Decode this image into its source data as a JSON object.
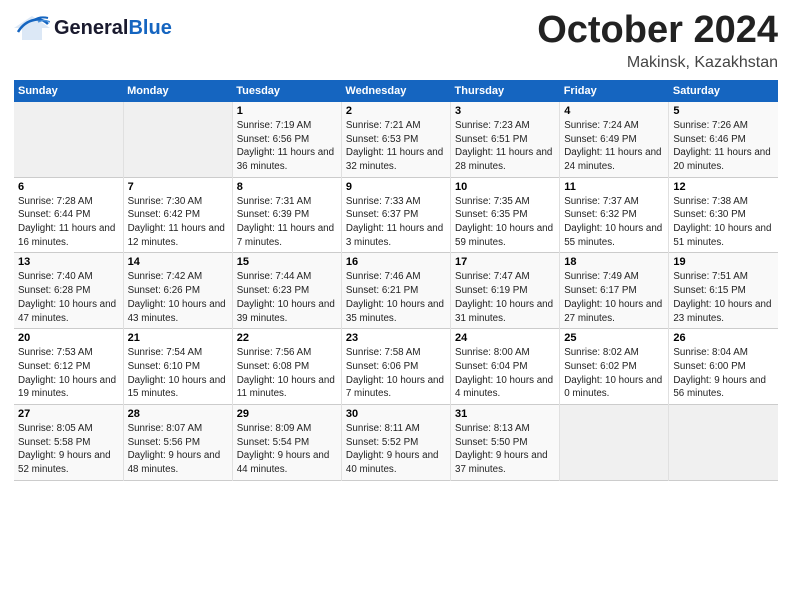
{
  "header": {
    "logo_general": "General",
    "logo_blue": "Blue",
    "month": "October 2024",
    "location": "Makinsk, Kazakhstan"
  },
  "weekdays": [
    "Sunday",
    "Monday",
    "Tuesday",
    "Wednesday",
    "Thursday",
    "Friday",
    "Saturday"
  ],
  "weeks": [
    [
      {
        "day": "",
        "empty": true
      },
      {
        "day": "",
        "empty": true
      },
      {
        "day": "1",
        "sunrise": "Sunrise: 7:19 AM",
        "sunset": "Sunset: 6:56 PM",
        "daylight": "Daylight: 11 hours and 36 minutes."
      },
      {
        "day": "2",
        "sunrise": "Sunrise: 7:21 AM",
        "sunset": "Sunset: 6:53 PM",
        "daylight": "Daylight: 11 hours and 32 minutes."
      },
      {
        "day": "3",
        "sunrise": "Sunrise: 7:23 AM",
        "sunset": "Sunset: 6:51 PM",
        "daylight": "Daylight: 11 hours and 28 minutes."
      },
      {
        "day": "4",
        "sunrise": "Sunrise: 7:24 AM",
        "sunset": "Sunset: 6:49 PM",
        "daylight": "Daylight: 11 hours and 24 minutes."
      },
      {
        "day": "5",
        "sunrise": "Sunrise: 7:26 AM",
        "sunset": "Sunset: 6:46 PM",
        "daylight": "Daylight: 11 hours and 20 minutes."
      }
    ],
    [
      {
        "day": "6",
        "sunrise": "Sunrise: 7:28 AM",
        "sunset": "Sunset: 6:44 PM",
        "daylight": "Daylight: 11 hours and 16 minutes."
      },
      {
        "day": "7",
        "sunrise": "Sunrise: 7:30 AM",
        "sunset": "Sunset: 6:42 PM",
        "daylight": "Daylight: 11 hours and 12 minutes."
      },
      {
        "day": "8",
        "sunrise": "Sunrise: 7:31 AM",
        "sunset": "Sunset: 6:39 PM",
        "daylight": "Daylight: 11 hours and 7 minutes."
      },
      {
        "day": "9",
        "sunrise": "Sunrise: 7:33 AM",
        "sunset": "Sunset: 6:37 PM",
        "daylight": "Daylight: 11 hours and 3 minutes."
      },
      {
        "day": "10",
        "sunrise": "Sunrise: 7:35 AM",
        "sunset": "Sunset: 6:35 PM",
        "daylight": "Daylight: 10 hours and 59 minutes."
      },
      {
        "day": "11",
        "sunrise": "Sunrise: 7:37 AM",
        "sunset": "Sunset: 6:32 PM",
        "daylight": "Daylight: 10 hours and 55 minutes."
      },
      {
        "day": "12",
        "sunrise": "Sunrise: 7:38 AM",
        "sunset": "Sunset: 6:30 PM",
        "daylight": "Daylight: 10 hours and 51 minutes."
      }
    ],
    [
      {
        "day": "13",
        "sunrise": "Sunrise: 7:40 AM",
        "sunset": "Sunset: 6:28 PM",
        "daylight": "Daylight: 10 hours and 47 minutes."
      },
      {
        "day": "14",
        "sunrise": "Sunrise: 7:42 AM",
        "sunset": "Sunset: 6:26 PM",
        "daylight": "Daylight: 10 hours and 43 minutes."
      },
      {
        "day": "15",
        "sunrise": "Sunrise: 7:44 AM",
        "sunset": "Sunset: 6:23 PM",
        "daylight": "Daylight: 10 hours and 39 minutes."
      },
      {
        "day": "16",
        "sunrise": "Sunrise: 7:46 AM",
        "sunset": "Sunset: 6:21 PM",
        "daylight": "Daylight: 10 hours and 35 minutes."
      },
      {
        "day": "17",
        "sunrise": "Sunrise: 7:47 AM",
        "sunset": "Sunset: 6:19 PM",
        "daylight": "Daylight: 10 hours and 31 minutes."
      },
      {
        "day": "18",
        "sunrise": "Sunrise: 7:49 AM",
        "sunset": "Sunset: 6:17 PM",
        "daylight": "Daylight: 10 hours and 27 minutes."
      },
      {
        "day": "19",
        "sunrise": "Sunrise: 7:51 AM",
        "sunset": "Sunset: 6:15 PM",
        "daylight": "Daylight: 10 hours and 23 minutes."
      }
    ],
    [
      {
        "day": "20",
        "sunrise": "Sunrise: 7:53 AM",
        "sunset": "Sunset: 6:12 PM",
        "daylight": "Daylight: 10 hours and 19 minutes."
      },
      {
        "day": "21",
        "sunrise": "Sunrise: 7:54 AM",
        "sunset": "Sunset: 6:10 PM",
        "daylight": "Daylight: 10 hours and 15 minutes."
      },
      {
        "day": "22",
        "sunrise": "Sunrise: 7:56 AM",
        "sunset": "Sunset: 6:08 PM",
        "daylight": "Daylight: 10 hours and 11 minutes."
      },
      {
        "day": "23",
        "sunrise": "Sunrise: 7:58 AM",
        "sunset": "Sunset: 6:06 PM",
        "daylight": "Daylight: 10 hours and 7 minutes."
      },
      {
        "day": "24",
        "sunrise": "Sunrise: 8:00 AM",
        "sunset": "Sunset: 6:04 PM",
        "daylight": "Daylight: 10 hours and 4 minutes."
      },
      {
        "day": "25",
        "sunrise": "Sunrise: 8:02 AM",
        "sunset": "Sunset: 6:02 PM",
        "daylight": "Daylight: 10 hours and 0 minutes."
      },
      {
        "day": "26",
        "sunrise": "Sunrise: 8:04 AM",
        "sunset": "Sunset: 6:00 PM",
        "daylight": "Daylight: 9 hours and 56 minutes."
      }
    ],
    [
      {
        "day": "27",
        "sunrise": "Sunrise: 8:05 AM",
        "sunset": "Sunset: 5:58 PM",
        "daylight": "Daylight: 9 hours and 52 minutes."
      },
      {
        "day": "28",
        "sunrise": "Sunrise: 8:07 AM",
        "sunset": "Sunset: 5:56 PM",
        "daylight": "Daylight: 9 hours and 48 minutes."
      },
      {
        "day": "29",
        "sunrise": "Sunrise: 8:09 AM",
        "sunset": "Sunset: 5:54 PM",
        "daylight": "Daylight: 9 hours and 44 minutes."
      },
      {
        "day": "30",
        "sunrise": "Sunrise: 8:11 AM",
        "sunset": "Sunset: 5:52 PM",
        "daylight": "Daylight: 9 hours and 40 minutes."
      },
      {
        "day": "31",
        "sunrise": "Sunrise: 8:13 AM",
        "sunset": "Sunset: 5:50 PM",
        "daylight": "Daylight: 9 hours and 37 minutes."
      },
      {
        "day": "",
        "empty": true
      },
      {
        "day": "",
        "empty": true
      }
    ]
  ]
}
